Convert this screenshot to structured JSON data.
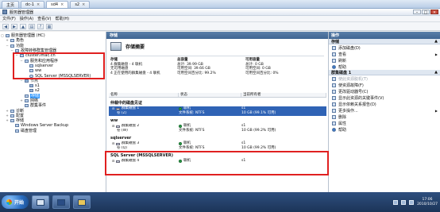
{
  "vm_tabs": [
    {
      "label": "主页",
      "active": false
    },
    {
      "label": "dc-1",
      "active": false
    },
    {
      "label": "sd4",
      "active": true
    },
    {
      "label": "s2",
      "active": false
    }
  ],
  "window": {
    "title": "服务器管理器",
    "menu": [
      "文件(F)",
      "操作(A)",
      "查看(V)",
      "帮助(H)"
    ]
  },
  "tree": [
    {
      "label": "服务器管理器 (HC)",
      "depth": 0,
      "icon": "server-manager-icon",
      "toggle": "▢"
    },
    {
      "label": "角色",
      "depth": 1,
      "icon": "roles-icon",
      "toggle": "+"
    },
    {
      "label": "功能",
      "depth": 1,
      "icon": "features-icon",
      "toggle": "−"
    },
    {
      "label": "故障转移群集管理器",
      "depth": 2,
      "icon": "cluster-manager-icon",
      "toggle": "−"
    },
    {
      "label": "cluster.imac.cn",
      "depth": 3,
      "icon": "cluster-icon",
      "toggle": "−"
    },
    {
      "label": "服务和应用程序",
      "depth": 4,
      "icon": "services-icon",
      "toggle": "−"
    },
    {
      "label": "sqlserver",
      "depth": 5,
      "icon": "service-icon",
      "toggle": ""
    },
    {
      "label": "ww",
      "depth": 5,
      "icon": "service-icon",
      "toggle": ""
    },
    {
      "label": "SQL Server (MSSQLSERVER)",
      "depth": 5,
      "icon": "sql-icon",
      "toggle": ""
    },
    {
      "label": "节点",
      "depth": 4,
      "icon": "nodes-icon",
      "toggle": "−"
    },
    {
      "label": "s1",
      "depth": 5,
      "icon": "node-icon",
      "toggle": ""
    },
    {
      "label": "s2",
      "depth": 5,
      "icon": "node-icon",
      "toggle": ""
    },
    {
      "label": "存储",
      "depth": 4,
      "icon": "storage-icon",
      "toggle": "",
      "selected": true
    },
    {
      "label": "网络",
      "depth": 4,
      "icon": "network-icon",
      "toggle": "+"
    },
    {
      "label": "群集事件",
      "depth": 4,
      "icon": "events-icon",
      "toggle": ""
    },
    {
      "label": "诊断",
      "depth": 1,
      "icon": "diagnostics-icon",
      "toggle": "+"
    },
    {
      "label": "配置",
      "depth": 1,
      "icon": "config-icon",
      "toggle": "+"
    },
    {
      "label": "存储",
      "depth": 1,
      "icon": "storage-root-icon",
      "toggle": "+"
    },
    {
      "label": "Windows Server Backup",
      "depth": 2,
      "icon": "backup-icon",
      "toggle": ""
    },
    {
      "label": "磁盘管理",
      "depth": 2,
      "icon": "disk-mgmt-icon",
      "toggle": ""
    }
  ],
  "center": {
    "pane_title": "存储",
    "summary_title": "存储摘要",
    "summary": {
      "col1": {
        "head": "存储",
        "lines": [
          "4 群集磁盘 - 4 联机",
          "无可用磁盘",
          "4 正在使用的群集磁盘 - 4 联机"
        ]
      },
      "col2": {
        "head": "总容量",
        "lines": [
          "总计: 39.99 GB",
          "可用空间: 39.66 GB",
          "可用空间百分比: 99.2%"
        ]
      },
      "col3": {
        "head": "可用容量",
        "lines": [
          "总计: 0 GB",
          "可用空间: 0 GB",
          "可用空间百分比: 0%"
        ]
      }
    },
    "columns": [
      "名称",
      "状态",
      "当前所有者"
    ],
    "groups": [
      {
        "title": "仲裁中的磁盘见证",
        "rows": [
          {
            "name": "群集磁盘 1",
            "status": "联机",
            "owner": "s1",
            "selected": true
          },
          {
            "name": "卷 (Z)",
            "status": "文件系统: NTFS",
            "owner": "10 GB (99.1% 可用)",
            "volume": true,
            "selected": true
          }
        ]
      },
      {
        "title": "ww",
        "rows": [
          {
            "name": "群集磁盘 2",
            "status": "联机",
            "owner": "s1"
          },
          {
            "name": "卷 (W)",
            "status": "文件系统: NTFS",
            "owner": "10 GB (99.2% 可用)",
            "volume": true
          }
        ]
      },
      {
        "title": "sqlserver",
        "rows": [
          {
            "name": "群集磁盘 3",
            "status": "联机",
            "owner": "s1"
          },
          {
            "name": "卷 (Q)",
            "status": "文件系统: NTFS",
            "owner": "10 GB (99.2% 可用)",
            "volume": true
          }
        ]
      },
      {
        "title": "SQL Server (MSSQLSERVER)",
        "rows": [
          {
            "name": "群集磁盘 4",
            "status": "联机",
            "owner": "s1"
          }
        ]
      }
    ]
  },
  "actions": {
    "title": "操作",
    "section1": {
      "title": "存储",
      "items": [
        {
          "label": "添加磁盘(D)",
          "icon": "add-disk-icon"
        },
        {
          "label": "查看",
          "icon": "view-icon",
          "submenu": true
        },
        {
          "label": "刷新",
          "icon": "refresh-icon"
        },
        {
          "label": "帮助",
          "icon": "help-icon"
        }
      ]
    },
    "section2": {
      "title": "群集磁盘 1",
      "items": [
        {
          "label": "使此资源脱机(T)",
          "icon": "offline-icon",
          "disabled": true
        },
        {
          "label": "使资源故障(F)",
          "icon": "fail-icon"
        },
        {
          "label": "更改驱动器号(C)",
          "icon": "drive-letter-icon"
        },
        {
          "label": "显示此资源的关键事件(V)",
          "icon": "events-icon"
        },
        {
          "label": "显示依赖关系报告(D)",
          "icon": "report-icon"
        },
        {
          "label": "更多操作...",
          "icon": "more-icon",
          "submenu": true
        },
        {
          "label": "删除",
          "icon": "delete-icon"
        },
        {
          "label": "属性",
          "icon": "properties-icon"
        },
        {
          "label": "帮助",
          "icon": "help-icon"
        }
      ]
    }
  },
  "taskbar": {
    "start_label": "开始",
    "time": "17:06",
    "date": "2010/10/27"
  }
}
